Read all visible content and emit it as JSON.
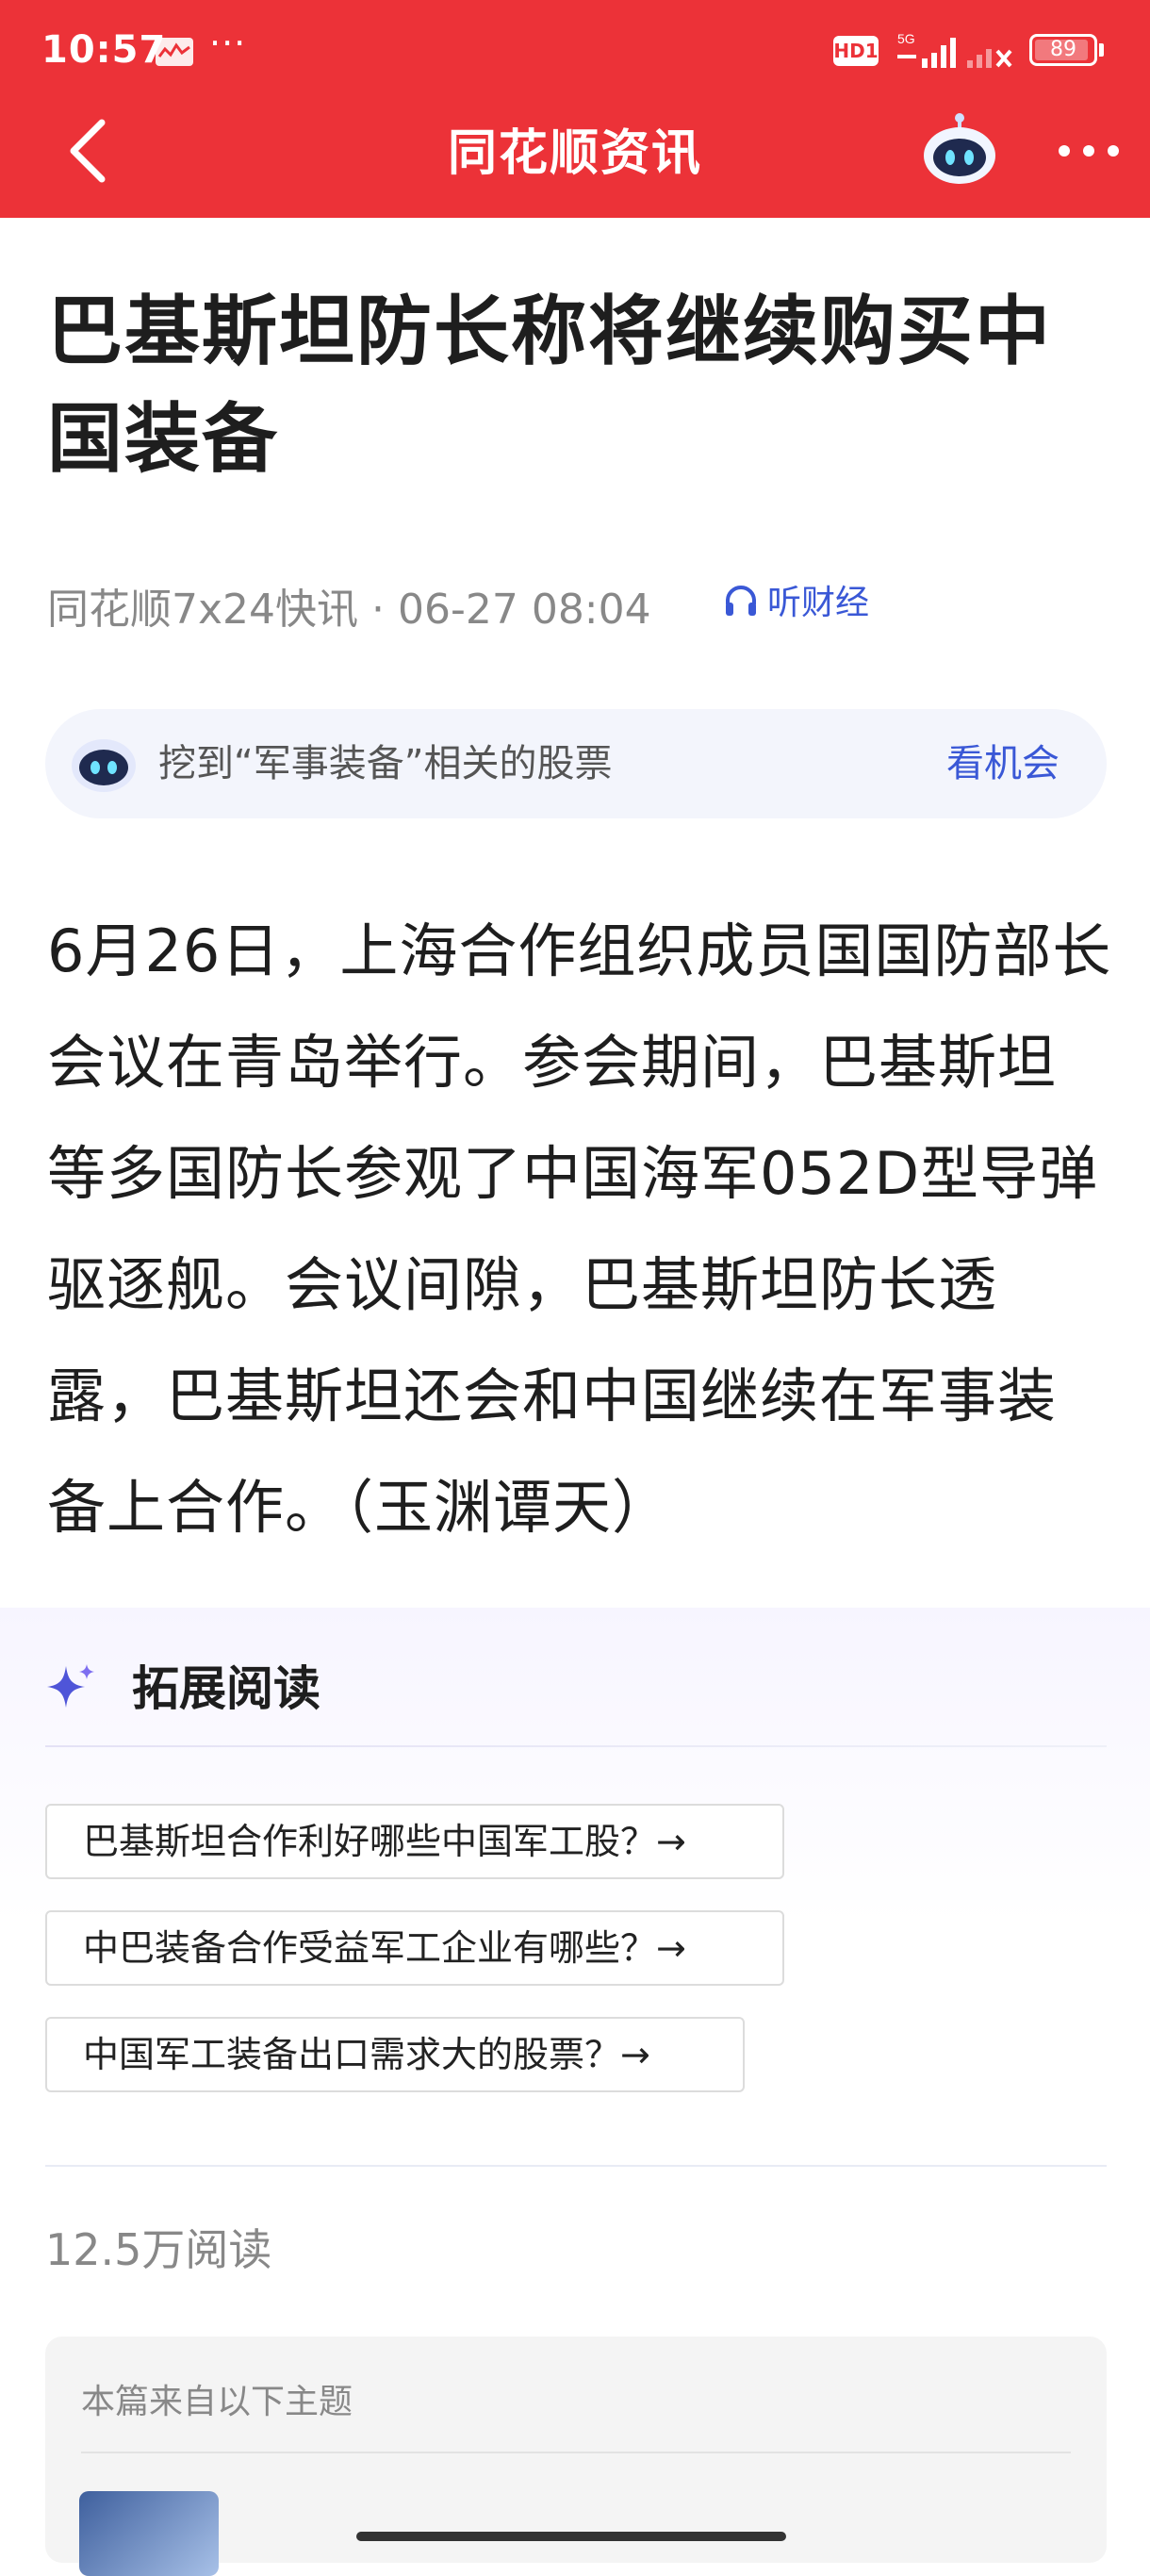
{
  "status_bar": {
    "time": "10:57",
    "more": "···",
    "network": "HD1",
    "signal_label": "5G",
    "battery": "89"
  },
  "nav": {
    "title": "同花顺资讯"
  },
  "article": {
    "title": "巴基斯坦防长称将继续购买中国装备",
    "source": "同花顺7x24快讯 · 06-27 08:04",
    "listen_label": "听财经",
    "body": "6月26日，上海合作组织成员国国防部长会议在青岛举行。参会期间，巴基斯坦等多国防长参观了中国海军052D型导弹驱逐舰。会议间隙，巴基斯坦防长透露，巴基斯坦还会和中国继续在军事装备上合作。（玉渊谭天）"
  },
  "ai_bar": {
    "text": "挖到“军事装备”相关的股票",
    "action": "看机会"
  },
  "extended_reading": {
    "title": "拓展阅读",
    "questions": [
      "巴基斯坦合作利好哪些中国军工股？→",
      "中巴装备合作受益军工企业有哪些？→",
      "中国军工装备出口需求大的股票？→"
    ]
  },
  "read_count": "12.5万阅读",
  "topic": {
    "label": "本篇来自以下主题"
  },
  "icons": [
    "back-arrow-icon",
    "robot-icon",
    "more-icon",
    "headphones-icon",
    "sparkle-icon",
    "battery-icon",
    "signal-icon"
  ],
  "colors": {
    "header": "#ec3238",
    "accent_blue": "#3a58d6"
  }
}
